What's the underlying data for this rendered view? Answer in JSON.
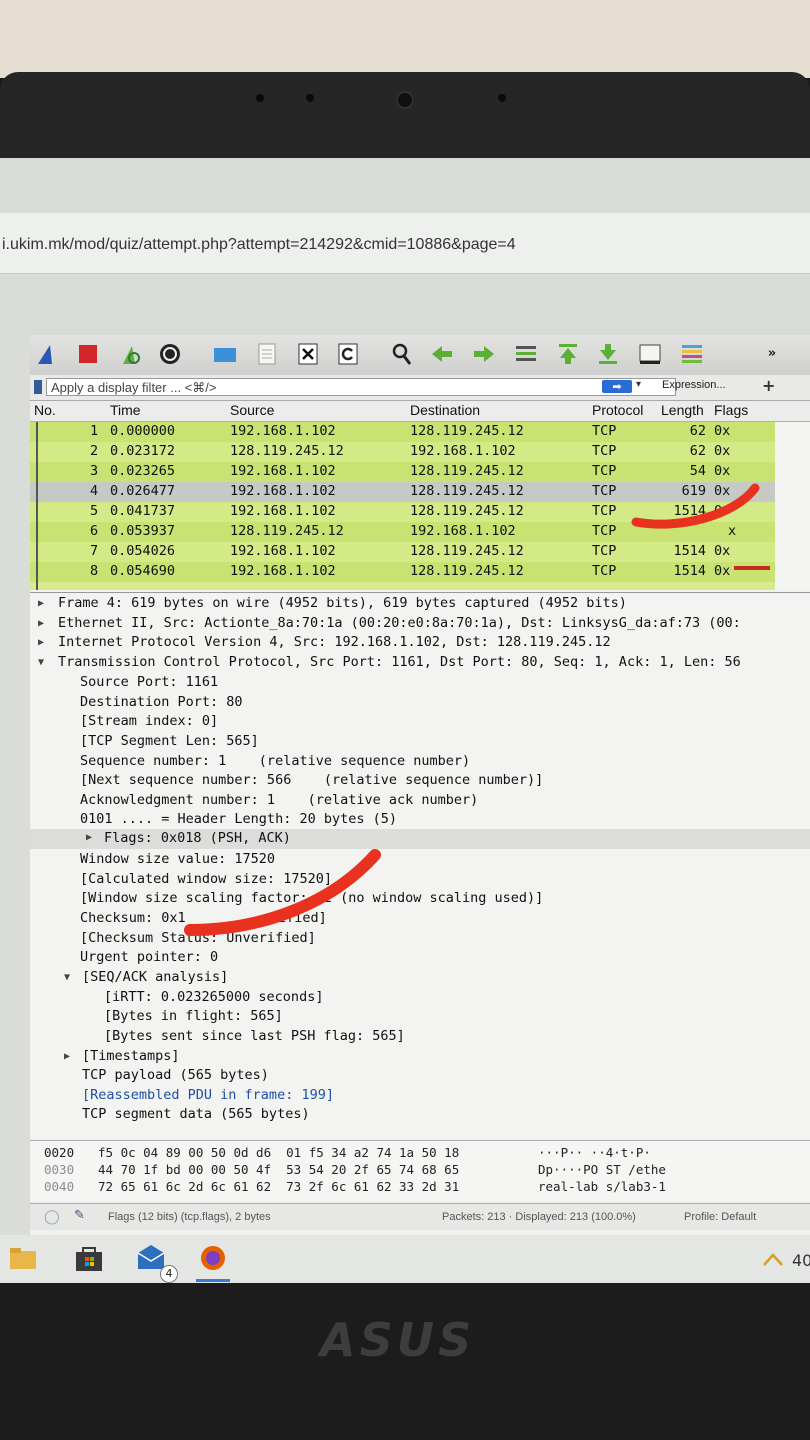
{
  "browser": {
    "url": "i.ukim.mk/mod/quiz/attempt.php?attempt=214292&cmid=10886&page=4"
  },
  "wireshark": {
    "toolbar_icons": [
      "shark-fin-icon",
      "stop-icon",
      "restart-icon",
      "options-icon",
      "open-file-icon",
      "save-file-icon",
      "close-file-icon",
      "reload-icon",
      "find-icon",
      "back-icon",
      "forward-icon",
      "go-to-packet-icon",
      "first-packet-icon",
      "last-packet-icon",
      "autoscroll-icon",
      "colorize-icon",
      "more-icon"
    ],
    "filter": {
      "placeholder": "Apply a display filter ... <⌘/>",
      "expression_label": "Expression...",
      "add_label": "+"
    },
    "packet_list": {
      "columns": [
        "No.",
        "Time",
        "Source",
        "Destination",
        "Protocol",
        "Length",
        "Flags"
      ],
      "rows": [
        {
          "no": "1",
          "time": "0.000000",
          "source": "192.168.1.102",
          "destination": "128.119.245.12",
          "protocol": "TCP",
          "length": "62",
          "flags": "0x"
        },
        {
          "no": "2",
          "time": "0.023172",
          "source": "128.119.245.12",
          "destination": "192.168.1.102",
          "protocol": "TCP",
          "length": "62",
          "flags": "0x"
        },
        {
          "no": "3",
          "time": "0.023265",
          "source": "192.168.1.102",
          "destination": "128.119.245.12",
          "protocol": "TCP",
          "length": "54",
          "flags": "0x"
        },
        {
          "no": "4",
          "time": "0.026477",
          "source": "192.168.1.102",
          "destination": "128.119.245.12",
          "protocol": "TCP",
          "length": "619",
          "flags": "0x"
        },
        {
          "no": "5",
          "time": "0.041737",
          "source": "192.168.1.102",
          "destination": "128.119.245.12",
          "protocol": "TCP",
          "length": "1514",
          "flags": "0"
        },
        {
          "no": "6",
          "time": "0.053937",
          "source": "128.119.245.12",
          "destination": "192.168.1.102",
          "protocol": "TCP",
          "length": "",
          "flags": "x"
        },
        {
          "no": "7",
          "time": "0.054026",
          "source": "192.168.1.102",
          "destination": "128.119.245.12",
          "protocol": "TCP",
          "length": "1514",
          "flags": "0x"
        },
        {
          "no": "8",
          "time": "0.054690",
          "source": "192.168.1.102",
          "destination": "128.119.245.12",
          "protocol": "TCP",
          "length": "1514",
          "flags": "0x"
        }
      ]
    },
    "details": {
      "frame": "Frame 4: 619 bytes on wire (4952 bits), 619 bytes captured (4952 bits)",
      "ethernet": "Ethernet II, Src: Actionte_8a:70:1a (00:20:e0:8a:70:1a), Dst: LinksysG_da:af:73 (00:",
      "ip": "Internet Protocol Version 4, Src: 192.168.1.102, Dst: 128.119.245.12",
      "tcp": "Transmission Control Protocol, Src Port: 1161, Dst Port: 80, Seq: 1, Ack: 1, Len: 56",
      "src_port": "Source Port: 1161",
      "dst_port": "Destination Port: 80",
      "stream": "[Stream index: 0]",
      "seg_len": "[TCP Segment Len: 565]",
      "seq": "Sequence number: 1    (relative sequence number)",
      "next_seq": "[Next sequence number: 566    (relative sequence number)]",
      "ack": "Acknowledgment number: 1    (relative ack number)",
      "header_len": "0101 .... = Header Length: 20 bytes (5)",
      "flags": "Flags: 0x018 (PSH, ACK)",
      "window": "Window size value: 17520",
      "calc_window": "[Calculated window size: 17520]",
      "window_scaling": "[Window size scaling factor: -2 (no window scaling used)]",
      "checksum": "Checksum: 0x1",
      "checksum_tail": "ified]",
      "checksum_status": "[Checksum Status: Unverified]",
      "urgent": "Urgent pointer: 0",
      "seq_ack": "[SEQ/ACK analysis]",
      "irtt": "[iRTT: 0.023265000 seconds]",
      "bytes_flight": "[Bytes in flight: 565]",
      "bytes_psh": "[Bytes sent since last PSH flag: 565]",
      "timestamps": "[Timestamps]",
      "payload": "TCP payload (565 bytes)",
      "reassembled": "[Reassembled PDU in frame: 199]",
      "segment_data": "TCP segment data (565 bytes)"
    },
    "hex": [
      {
        "offset": "0020",
        "bytes": "f5 0c 04 89 00 50 0d d6  01 f5 34 a2 74 1a 50 18",
        "ascii": "···P·· ··4·t·P·"
      },
      {
        "offset": "0030",
        "bytes": "44 70 1f bd 00 00 50 4f  53 54 20 2f 65 74 68 65",
        "ascii": "Dp····PO ST /ethe"
      },
      {
        "offset": "0040",
        "bytes": "72 65 61 6c 2d 6c 61 62  73 2f 6c 61 62 33 2d 31",
        "ascii": "real-lab s/lab3-1"
      }
    ],
    "status": {
      "field": "Flags (12 bits) (tcp.flags), 2 bytes",
      "packets": "Packets: 213 · Displayed: 213 (100.0%)",
      "profile": "Profile: Default"
    }
  },
  "taskbar": {
    "mail_badge": "4",
    "clock_partial": "40"
  },
  "laptop": {
    "brand": "ASUS"
  },
  "colors": {
    "packet_green": "#c9e373",
    "selected_row": "#c6c9c4",
    "annotation_red": "#e8321f"
  }
}
